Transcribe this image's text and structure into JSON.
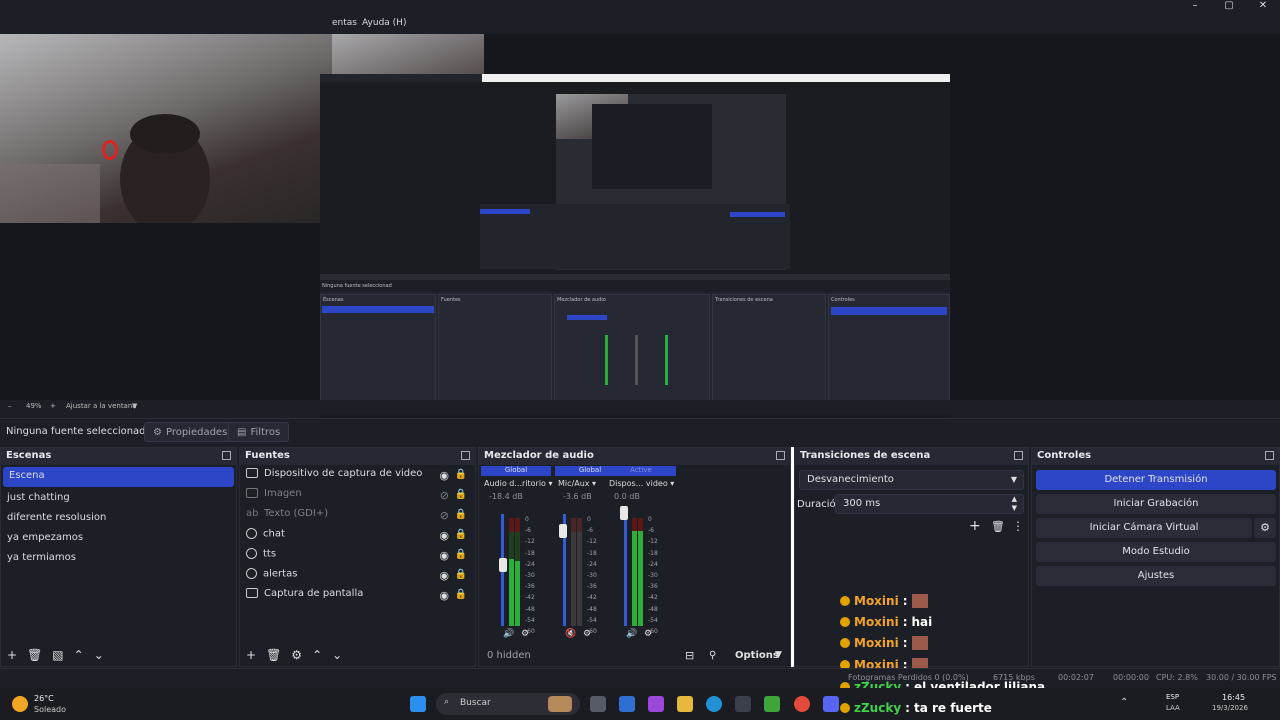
{
  "window": {
    "menu_items": [
      "entas",
      "Ayuda (H)"
    ],
    "minimize": "–",
    "maximize": "▢",
    "close": "✕"
  },
  "preview_zoom": {
    "zoom_out": "–",
    "zoom_level": "49%",
    "zoom_in": "+",
    "fit_label": "Ajustar a la ventana"
  },
  "property_bar": {
    "selection": "Ninguna fuente seleccionad",
    "properties_label": "Propiedades",
    "filters_label": "Filtros"
  },
  "scenes": {
    "title": "Escenas",
    "items": [
      "Escena",
      "just chatting",
      "diferente resolusion",
      "ya empezamos",
      "ya termiamos"
    ],
    "selected_index": 0
  },
  "sources": {
    "title": "Fuentes",
    "items": [
      {
        "label": "Dispositivo de captura de video",
        "icon": "camera-icon",
        "visible": true
      },
      {
        "label": "Imagen",
        "icon": "image-icon",
        "visible": false
      },
      {
        "label": "Texto (GDI+)",
        "icon": "text-icon",
        "visible": false
      },
      {
        "label": "chat",
        "icon": "globe-icon",
        "visible": true
      },
      {
        "label": "tts",
        "icon": "globe-icon",
        "visible": true
      },
      {
        "label": "alertas",
        "icon": "globe-icon",
        "visible": true
      },
      {
        "label": "Captura de pantalla",
        "icon": "monitor-icon",
        "visible": true
      }
    ]
  },
  "mixer": {
    "title": "Mezclador de audio",
    "channels": [
      {
        "tag": "Global",
        "name": "Audio d...ritorio",
        "db": "-18.4 dB",
        "level": 0.62,
        "fader": 0.55,
        "muted": false
      },
      {
        "tag": "Global",
        "name": "Mic/Aux",
        "db": "-3.6 dB",
        "level": 0.0,
        "fader": 0.85,
        "muted": true
      },
      {
        "tag": "Active",
        "name": "Dispos... video",
        "db": "0.0 dB",
        "level": 0.92,
        "fader": 1.0,
        "muted": false
      }
    ],
    "scale": [
      "0",
      "-6",
      "-12",
      "-18",
      "-24",
      "-30",
      "-36",
      "-42",
      "-48",
      "-54",
      "-60"
    ],
    "hidden_label": "0 hidden",
    "options_label": "Options"
  },
  "transitions": {
    "title": "Transiciones de escena",
    "selected": "Desvanecimiento",
    "duration_label": "Duración",
    "duration_value": "300 ms"
  },
  "controls": {
    "title": "Controles",
    "buttons": [
      "Detener Transmisión",
      "Iniciar Grabación",
      "Iniciar Cámara Virtual",
      "Modo Estudio",
      "Ajustes"
    ]
  },
  "chat": [
    {
      "user": "Moxini",
      "text": "",
      "color": "#f4a228",
      "emote": true
    },
    {
      "user": "Moxini",
      "text": "hai",
      "color": "#f4a228",
      "emote": false
    },
    {
      "user": "Moxini",
      "text": "",
      "color": "#f4a228",
      "emote": true
    },
    {
      "user": "Moxini",
      "text": "",
      "color": "#f4a228",
      "emote": true
    },
    {
      "user": "zZucky",
      "text": "el ventilador liliana",
      "color": "#3fd24a",
      "emote": false
    },
    {
      "user": "zZucky",
      "text": "ta re fuerte",
      "color": "#3fd24a",
      "emote": false
    }
  ],
  "status": {
    "dropped": "Fotogramas Perdidos 0 (0.0%)",
    "bitrate": "6715 kbps",
    "stream_time": "00:02:07",
    "rec_time": "00:00:00",
    "cpu": "CPU: 2.8%",
    "fps": "30.00 / 30.00 FPS"
  },
  "taskbar": {
    "temp": "26°C",
    "weather": "Soleado",
    "search_placeholder": "Buscar",
    "lang": "ESP",
    "lang2": "LAA",
    "time": "16:45",
    "date": "19/3/2026"
  }
}
